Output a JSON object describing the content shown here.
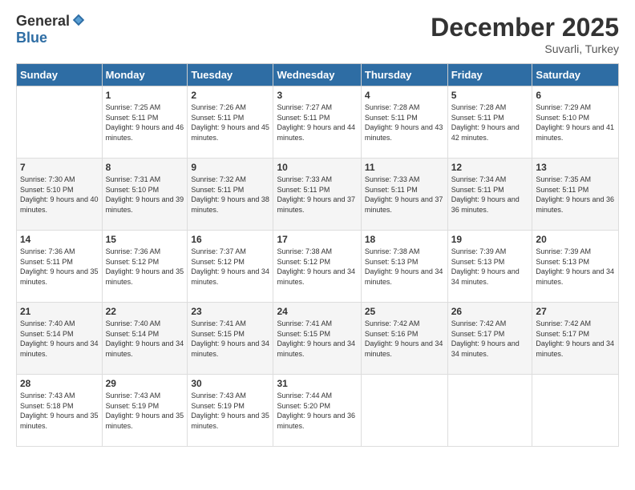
{
  "logo": {
    "general": "General",
    "blue": "Blue"
  },
  "header": {
    "month": "December 2025",
    "location": "Suvarli, Turkey"
  },
  "weekdays": [
    "Sunday",
    "Monday",
    "Tuesday",
    "Wednesday",
    "Thursday",
    "Friday",
    "Saturday"
  ],
  "weeks": [
    [
      {
        "day": "",
        "sunrise": "",
        "sunset": "",
        "daylight": ""
      },
      {
        "day": "1",
        "sunrise": "Sunrise: 7:25 AM",
        "sunset": "Sunset: 5:11 PM",
        "daylight": "Daylight: 9 hours and 46 minutes."
      },
      {
        "day": "2",
        "sunrise": "Sunrise: 7:26 AM",
        "sunset": "Sunset: 5:11 PM",
        "daylight": "Daylight: 9 hours and 45 minutes."
      },
      {
        "day": "3",
        "sunrise": "Sunrise: 7:27 AM",
        "sunset": "Sunset: 5:11 PM",
        "daylight": "Daylight: 9 hours and 44 minutes."
      },
      {
        "day": "4",
        "sunrise": "Sunrise: 7:28 AM",
        "sunset": "Sunset: 5:11 PM",
        "daylight": "Daylight: 9 hours and 43 minutes."
      },
      {
        "day": "5",
        "sunrise": "Sunrise: 7:28 AM",
        "sunset": "Sunset: 5:11 PM",
        "daylight": "Daylight: 9 hours and 42 minutes."
      },
      {
        "day": "6",
        "sunrise": "Sunrise: 7:29 AM",
        "sunset": "Sunset: 5:10 PM",
        "daylight": "Daylight: 9 hours and 41 minutes."
      }
    ],
    [
      {
        "day": "7",
        "sunrise": "Sunrise: 7:30 AM",
        "sunset": "Sunset: 5:10 PM",
        "daylight": "Daylight: 9 hours and 40 minutes."
      },
      {
        "day": "8",
        "sunrise": "Sunrise: 7:31 AM",
        "sunset": "Sunset: 5:10 PM",
        "daylight": "Daylight: 9 hours and 39 minutes."
      },
      {
        "day": "9",
        "sunrise": "Sunrise: 7:32 AM",
        "sunset": "Sunset: 5:11 PM",
        "daylight": "Daylight: 9 hours and 38 minutes."
      },
      {
        "day": "10",
        "sunrise": "Sunrise: 7:33 AM",
        "sunset": "Sunset: 5:11 PM",
        "daylight": "Daylight: 9 hours and 37 minutes."
      },
      {
        "day": "11",
        "sunrise": "Sunrise: 7:33 AM",
        "sunset": "Sunset: 5:11 PM",
        "daylight": "Daylight: 9 hours and 37 minutes."
      },
      {
        "day": "12",
        "sunrise": "Sunrise: 7:34 AM",
        "sunset": "Sunset: 5:11 PM",
        "daylight": "Daylight: 9 hours and 36 minutes."
      },
      {
        "day": "13",
        "sunrise": "Sunrise: 7:35 AM",
        "sunset": "Sunset: 5:11 PM",
        "daylight": "Daylight: 9 hours and 36 minutes."
      }
    ],
    [
      {
        "day": "14",
        "sunrise": "Sunrise: 7:36 AM",
        "sunset": "Sunset: 5:11 PM",
        "daylight": "Daylight: 9 hours and 35 minutes."
      },
      {
        "day": "15",
        "sunrise": "Sunrise: 7:36 AM",
        "sunset": "Sunset: 5:12 PM",
        "daylight": "Daylight: 9 hours and 35 minutes."
      },
      {
        "day": "16",
        "sunrise": "Sunrise: 7:37 AM",
        "sunset": "Sunset: 5:12 PM",
        "daylight": "Daylight: 9 hours and 34 minutes."
      },
      {
        "day": "17",
        "sunrise": "Sunrise: 7:38 AM",
        "sunset": "Sunset: 5:12 PM",
        "daylight": "Daylight: 9 hours and 34 minutes."
      },
      {
        "day": "18",
        "sunrise": "Sunrise: 7:38 AM",
        "sunset": "Sunset: 5:13 PM",
        "daylight": "Daylight: 9 hours and 34 minutes."
      },
      {
        "day": "19",
        "sunrise": "Sunrise: 7:39 AM",
        "sunset": "Sunset: 5:13 PM",
        "daylight": "Daylight: 9 hours and 34 minutes."
      },
      {
        "day": "20",
        "sunrise": "Sunrise: 7:39 AM",
        "sunset": "Sunset: 5:13 PM",
        "daylight": "Daylight: 9 hours and 34 minutes."
      }
    ],
    [
      {
        "day": "21",
        "sunrise": "Sunrise: 7:40 AM",
        "sunset": "Sunset: 5:14 PM",
        "daylight": "Daylight: 9 hours and 34 minutes."
      },
      {
        "day": "22",
        "sunrise": "Sunrise: 7:40 AM",
        "sunset": "Sunset: 5:14 PM",
        "daylight": "Daylight: 9 hours and 34 minutes."
      },
      {
        "day": "23",
        "sunrise": "Sunrise: 7:41 AM",
        "sunset": "Sunset: 5:15 PM",
        "daylight": "Daylight: 9 hours and 34 minutes."
      },
      {
        "day": "24",
        "sunrise": "Sunrise: 7:41 AM",
        "sunset": "Sunset: 5:15 PM",
        "daylight": "Daylight: 9 hours and 34 minutes."
      },
      {
        "day": "25",
        "sunrise": "Sunrise: 7:42 AM",
        "sunset": "Sunset: 5:16 PM",
        "daylight": "Daylight: 9 hours and 34 minutes."
      },
      {
        "day": "26",
        "sunrise": "Sunrise: 7:42 AM",
        "sunset": "Sunset: 5:17 PM",
        "daylight": "Daylight: 9 hours and 34 minutes."
      },
      {
        "day": "27",
        "sunrise": "Sunrise: 7:42 AM",
        "sunset": "Sunset: 5:17 PM",
        "daylight": "Daylight: 9 hours and 34 minutes."
      }
    ],
    [
      {
        "day": "28",
        "sunrise": "Sunrise: 7:43 AM",
        "sunset": "Sunset: 5:18 PM",
        "daylight": "Daylight: 9 hours and 35 minutes."
      },
      {
        "day": "29",
        "sunrise": "Sunrise: 7:43 AM",
        "sunset": "Sunset: 5:19 PM",
        "daylight": "Daylight: 9 hours and 35 minutes."
      },
      {
        "day": "30",
        "sunrise": "Sunrise: 7:43 AM",
        "sunset": "Sunset: 5:19 PM",
        "daylight": "Daylight: 9 hours and 35 minutes."
      },
      {
        "day": "31",
        "sunrise": "Sunrise: 7:44 AM",
        "sunset": "Sunset: 5:20 PM",
        "daylight": "Daylight: 9 hours and 36 minutes."
      },
      {
        "day": "",
        "sunrise": "",
        "sunset": "",
        "daylight": ""
      },
      {
        "day": "",
        "sunrise": "",
        "sunset": "",
        "daylight": ""
      },
      {
        "day": "",
        "sunrise": "",
        "sunset": "",
        "daylight": ""
      }
    ]
  ]
}
